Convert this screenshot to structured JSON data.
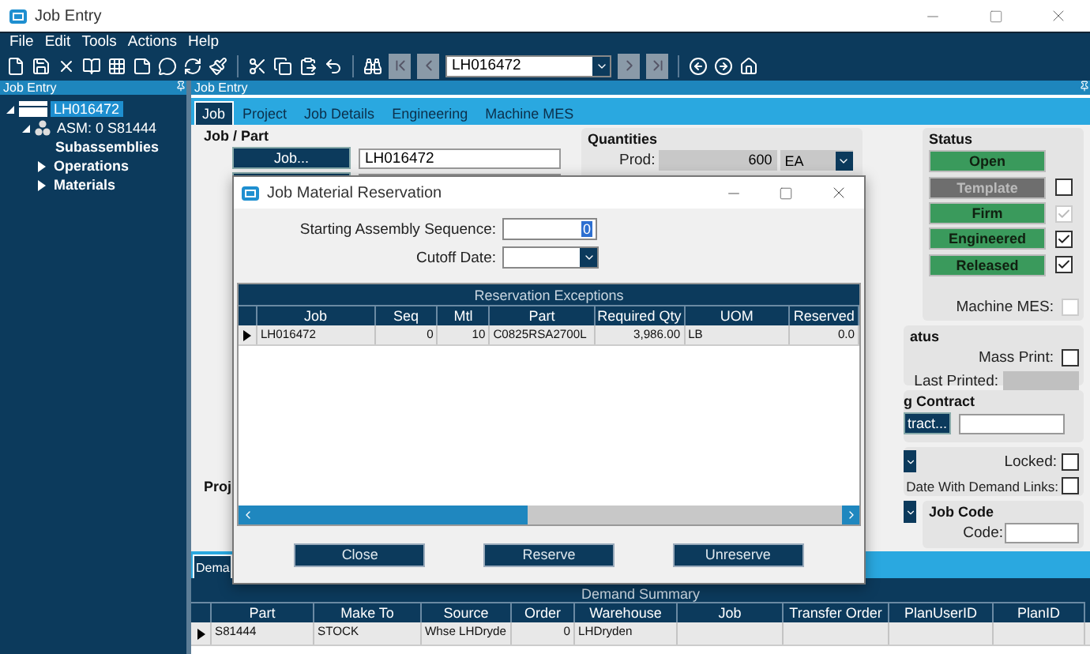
{
  "window": {
    "title": "Job Entry"
  },
  "menu": [
    "File",
    "Edit",
    "Tools",
    "Actions",
    "Help"
  ],
  "toolbar": {
    "record_value": "LH016472"
  },
  "left_panel": {
    "title": "Job Entry",
    "tree": [
      {
        "label": "LH016472",
        "selected": true,
        "expanded": true,
        "kind": "job",
        "children": [
          {
            "label": "ASM: 0 S81444",
            "selected": false,
            "expanded": true,
            "kind": "assembly",
            "children": [
              {
                "label": "Subassemblies",
                "selected": false,
                "kind": "plain"
              },
              {
                "label": "Operations",
                "selected": false,
                "expanded": false,
                "kind": "plain"
              },
              {
                "label": "Materials",
                "selected": false,
                "expanded": false,
                "kind": "plain"
              }
            ]
          }
        ]
      }
    ]
  },
  "main_panel": {
    "title": "Job Entry",
    "tabs": [
      {
        "label": "Job",
        "selected": true
      },
      {
        "label": "Project",
        "selected": false
      },
      {
        "label": "Job Details",
        "selected": false
      },
      {
        "label": "Engineering",
        "selected": false
      },
      {
        "label": "Machine MES",
        "selected": false
      }
    ],
    "job_part": {
      "title": "Job / Part",
      "job_button": "Job...",
      "job_value": "LH016472"
    },
    "project_label": "Proj",
    "quantities": {
      "title": "Quantities",
      "prod_label": "Prod:",
      "prod_value": "600",
      "uom": "EA"
    },
    "status": {
      "title": "Status",
      "buttons": [
        {
          "label": "Open",
          "disabled": false
        },
        {
          "label": "Template",
          "disabled": true,
          "checkbox": {
            "checked": false,
            "disabled": false
          }
        },
        {
          "label": "Firm",
          "disabled": false,
          "checkbox": {
            "checked": true,
            "disabled": true
          }
        },
        {
          "label": "Engineered",
          "disabled": false,
          "checkbox": {
            "checked": true,
            "disabled": false
          }
        },
        {
          "label": "Released",
          "disabled": false,
          "checkbox": {
            "checked": true,
            "disabled": false
          }
        }
      ],
      "machine_mes": {
        "label": "Machine MES:",
        "checked": false,
        "disabled": true
      }
    },
    "print_status": {
      "title": "atus",
      "mass_print_label": "Mass Print:",
      "mass_print_checked": false,
      "last_printed_label": "Last Printed:"
    },
    "contract": {
      "title": "g Contract",
      "button": "tract..."
    },
    "links": {
      "locked_label": "Locked:",
      "locked_checked": false,
      "demand_label": "Date With Demand Links:",
      "demand_checked": false
    },
    "job_code": {
      "title": "Job Code",
      "code_label": "Code:"
    },
    "bottom_tabs": [
      {
        "label": "Dema",
        "selected": true
      }
    ],
    "demand_summary": {
      "title": "Demand Summary",
      "columns": [
        "Part",
        "Make To",
        "Source",
        "Order",
        "Warehouse",
        "Job",
        "Transfer Order",
        "PlanUserID",
        "PlanID"
      ],
      "rows": [
        [
          "S81444",
          "STOCK",
          "Whse LHDryde",
          "0",
          "LHDryden",
          "",
          "",
          "",
          ""
        ]
      ]
    }
  },
  "dialog": {
    "title": "Job Material Reservation",
    "seq_label": "Starting Assembly Sequence:",
    "seq_value": "0",
    "cutoff_label": "Cutoff Date:",
    "grid": {
      "title": "Reservation Exceptions",
      "columns": [
        "Job",
        "Seq",
        "Mtl",
        "Part",
        "Required Qty",
        "UOM",
        "Reserved"
      ],
      "rows": [
        [
          "LH016472",
          "0",
          "10",
          "C0825RSA2700L",
          "3,986.00",
          "LB",
          "0.0"
        ]
      ]
    },
    "buttons": [
      "Close",
      "Reserve",
      "Unreserve"
    ]
  }
}
